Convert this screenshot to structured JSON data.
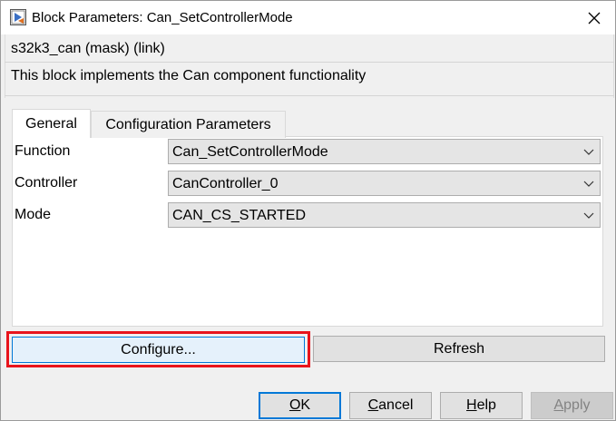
{
  "window": {
    "title": "Block Parameters: Can_SetControllerMode",
    "app_icon": "simulink-block-icon",
    "close_icon": "close-icon"
  },
  "description": {
    "mask_type": "s32k3_can (mask) (link)",
    "text": "This block implements the Can component functionality"
  },
  "tabs": [
    {
      "label": "General",
      "selected": true
    },
    {
      "label": "Configuration Parameters",
      "selected": false
    }
  ],
  "parameters": [
    {
      "label": "Function",
      "value": "Can_SetControllerMode"
    },
    {
      "label": "Controller",
      "value": "CanController_0"
    },
    {
      "label": "Mode",
      "value": "CAN_CS_STARTED"
    }
  ],
  "actions": {
    "configure_label": "Configure...",
    "refresh_label": "Refresh"
  },
  "footer": {
    "ok_label": "OK",
    "ok_mnemonic": "O",
    "ok_rest": "K",
    "cancel_mnemonic": "C",
    "cancel_rest": "ancel",
    "help_mnemonic": "H",
    "help_rest": "elp",
    "apply_mnemonic": "A",
    "apply_rest": "pply"
  },
  "colors": {
    "highlight": "#e8141c",
    "focus_accent": "#0078d7"
  }
}
